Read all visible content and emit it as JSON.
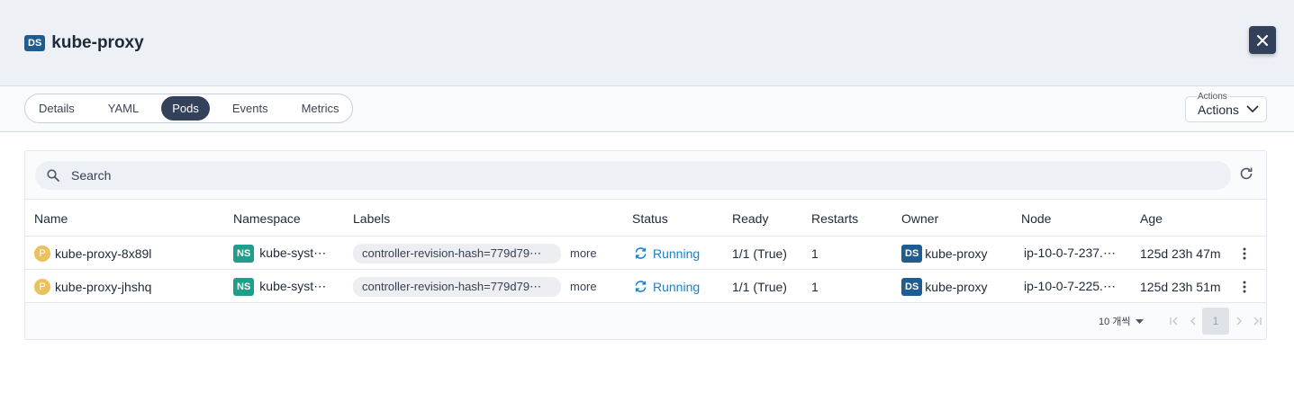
{
  "header": {
    "kind_badge": "DS",
    "title": "kube-proxy"
  },
  "tabs": [
    {
      "label": "Details",
      "active": false
    },
    {
      "label": "YAML",
      "active": false
    },
    {
      "label": "Pods",
      "active": true
    },
    {
      "label": "Events",
      "active": false
    },
    {
      "label": "Metrics",
      "active": false
    }
  ],
  "actions": {
    "legend": "Actions",
    "label": "Actions"
  },
  "search": {
    "placeholder": "Search"
  },
  "table": {
    "columns": [
      "Name",
      "Namespace",
      "Labels",
      "Status",
      "Ready",
      "Restarts",
      "Owner",
      "Node",
      "Age"
    ],
    "rows": [
      {
        "badge": "P",
        "name": "kube-proxy-8x89l",
        "ns_badge": "NS",
        "namespace": "kube-syst⋯",
        "label": "controller-revision-hash=779d79⋯",
        "more": "more",
        "status": "Running",
        "ready": "1/1 (True)",
        "restarts": "1",
        "owner_badge": "DS",
        "owner": "kube-proxy",
        "node": "ip-10-0-7-237.⋯",
        "age": "125d 23h 47m"
      },
      {
        "badge": "P",
        "name": "kube-proxy-jhshq",
        "ns_badge": "NS",
        "namespace": "kube-syst⋯",
        "label": "controller-revision-hash=779d79⋯",
        "more": "more",
        "status": "Running",
        "ready": "1/1 (True)",
        "restarts": "1",
        "owner_badge": "DS",
        "owner": "kube-proxy",
        "node": "ip-10-0-7-225.⋯",
        "age": "125d 23h 51m"
      }
    ]
  },
  "pagination": {
    "rows_per_page": "10 개씩",
    "current_page": "1"
  },
  "colors": {
    "accent": "#33425a",
    "status_running": "#1b82c9",
    "ds_badge": "#1f5c8f",
    "ns_badge": "#1f9e8a",
    "pod_badge": "#e9c15d"
  }
}
